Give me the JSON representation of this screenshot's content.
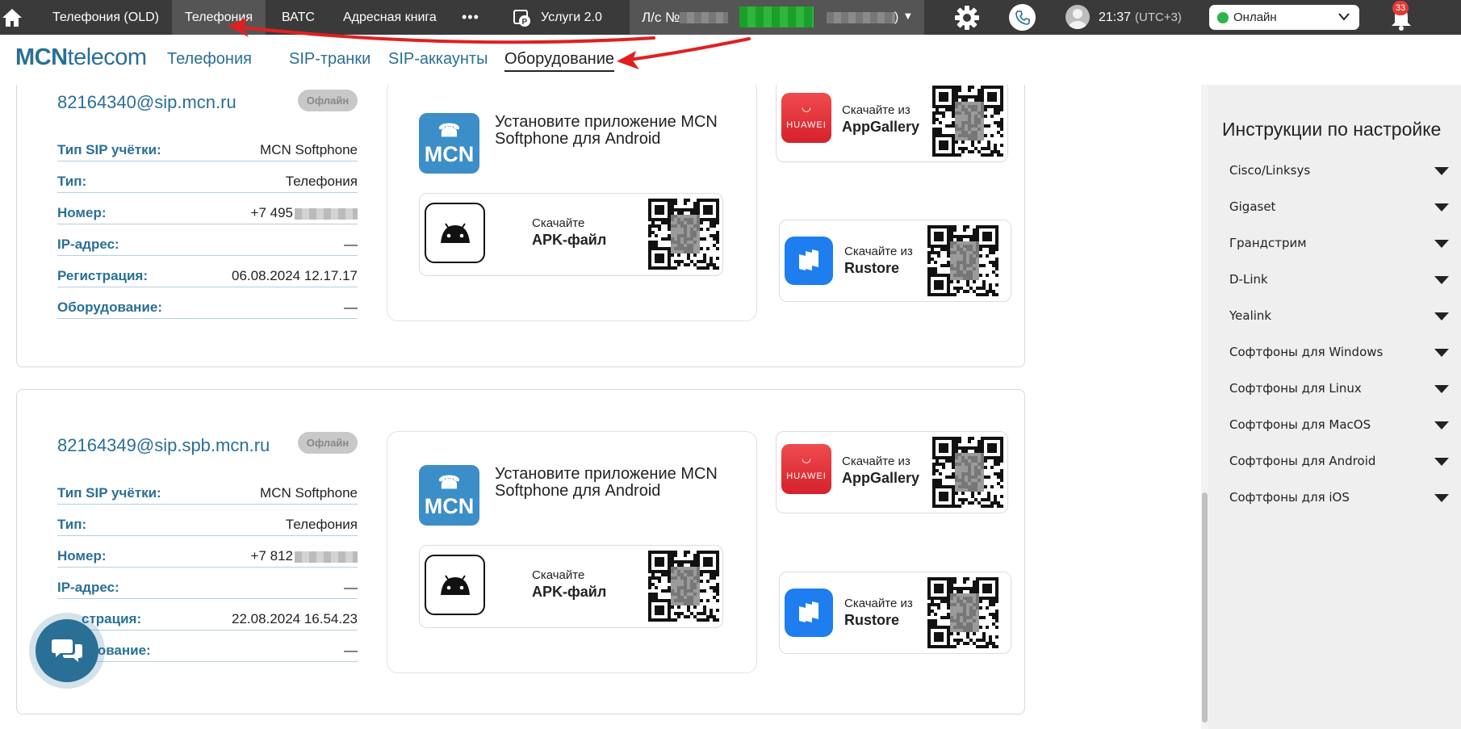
{
  "topbar": {
    "tabs": [
      "Телефония (OLD)",
      "Телефония",
      "ВАТС",
      "Адресная книга"
    ],
    "more": "•••",
    "services": "Услуги 2.0",
    "account_prefix": "Л/с №",
    "account_suffix": ")",
    "time": "21:37",
    "timezone": "(UTC+3)",
    "status": "Онлайн",
    "notifications": "33"
  },
  "subnav": {
    "logo_bold": "MCN",
    "logo_rest": "telecom",
    "links": [
      "Телефония",
      "SIP-транки",
      "SIP-аккаунты",
      "Оборудование"
    ]
  },
  "cards": [
    {
      "sip": "82164340@sip.mcn.ru",
      "status": "Офлайн",
      "rows": [
        {
          "k": "Тип SIP учётки:",
          "v": "MCN Softphone"
        },
        {
          "k": "Тип:",
          "v": "Телефония"
        },
        {
          "k": "Номер:",
          "v": "+7 495"
        },
        {
          "k": "IP-адрес:",
          "v": "—"
        },
        {
          "k": "Регистрация:",
          "v": "06.08.2024 12.17.17"
        },
        {
          "k": "Оборудование:",
          "v": "—"
        }
      ]
    },
    {
      "sip": "82164349@sip.spb.mcn.ru",
      "status": "Офлайн",
      "rows": [
        {
          "k": "Тип SIP учётки:",
          "v": "MCN Softphone"
        },
        {
          "k": "Тип:",
          "v": "Телефония"
        },
        {
          "k": "Номер:",
          "v": "+7 812"
        },
        {
          "k": "IP-адрес:",
          "v": "—"
        },
        {
          "k": "страция:",
          "v": "22.08.2024 16.54.23"
        },
        {
          "k": "удование:",
          "v": "—"
        }
      ]
    }
  ],
  "app": {
    "mcn_logo": "MCN",
    "install_text": "Установите приложение MCN Softphone для Android",
    "download": "Скачайте",
    "apk": "APK-файл",
    "download_from": "Скачайте из",
    "appgallery": "AppGallery",
    "rustore": "Rustore",
    "huawei": "HUAWEI"
  },
  "sidebar": {
    "title": "Инструкции по настройке",
    "items": [
      "Cisco/Linksys",
      "Gigaset",
      "Грандстрим",
      "D-Link",
      "Yealink",
      "Софтфоны для Windows",
      "Софтфоны для Linux",
      "Софтфоны для MacOS",
      "Софтфоны для Android",
      "Софтфоны для iOS"
    ]
  },
  "colors": {
    "brand": "#2a6f96",
    "topbar": "#3a3a3a",
    "online": "#2db54c",
    "annotation": "#e02020"
  }
}
